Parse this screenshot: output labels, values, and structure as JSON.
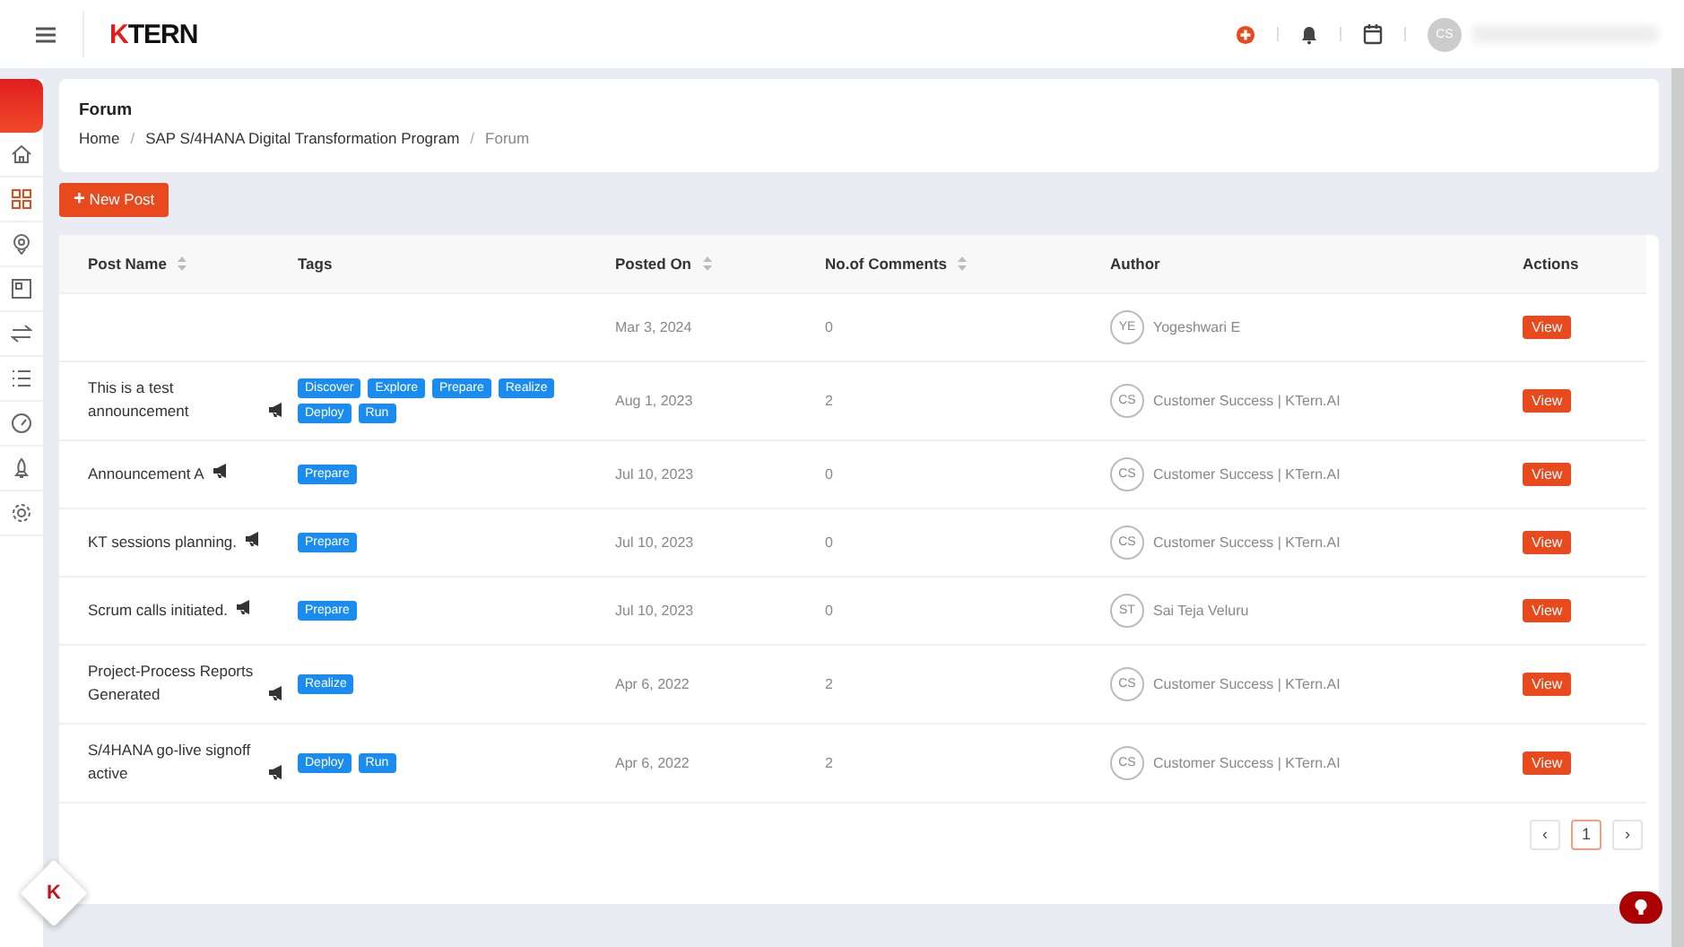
{
  "topbar": {
    "logo": {
      "mark": "K",
      "text": "TERN"
    },
    "avatar_initials": "CS"
  },
  "sidebar": {
    "items": [
      {
        "selected": false
      },
      {
        "selected": true
      },
      {
        "selected": false
      },
      {
        "selected": false
      },
      {
        "selected": false
      },
      {
        "selected": false
      },
      {
        "selected": false
      },
      {
        "selected": false
      },
      {
        "selected": false
      }
    ]
  },
  "page": {
    "title": "Forum",
    "breadcrumb": [
      "Home",
      "SAP S/4HANA Digital Transformation Program",
      "Forum"
    ],
    "breadcrumb_separator": "/"
  },
  "new_post_button": {
    "icon": "+",
    "label": "New Post"
  },
  "table": {
    "columns": [
      {
        "label": "Post Name",
        "sortable": true
      },
      {
        "label": "Tags",
        "sortable": false
      },
      {
        "label": "Posted On",
        "sortable": true
      },
      {
        "label": "No.of Comments",
        "sortable": true
      },
      {
        "label": "Author",
        "sortable": false
      },
      {
        "label": "Actions",
        "sortable": false
      }
    ],
    "rows": [
      {
        "name": "",
        "announcement": false,
        "tags": [],
        "posted_on": "Mar 3, 2024",
        "comments": "0",
        "author_initials": "YE",
        "author": "Yogeshwari E",
        "action": "View"
      },
      {
        "name": "This is a test announcement",
        "announcement": true,
        "tags": [
          "Discover",
          "Explore",
          "Prepare",
          "Realize",
          "Deploy",
          "Run"
        ],
        "posted_on": "Aug 1, 2023",
        "comments": "2",
        "author_initials": "CS",
        "author": "Customer Success | KTern.AI",
        "action": "View"
      },
      {
        "name": "Announcement A",
        "announcement": true,
        "tags": [
          "Prepare"
        ],
        "posted_on": "Jul 10, 2023",
        "comments": "0",
        "author_initials": "CS",
        "author": "Customer Success | KTern.AI",
        "action": "View"
      },
      {
        "name": "KT sessions planning.",
        "announcement": true,
        "tags": [
          "Prepare"
        ],
        "posted_on": "Jul 10, 2023",
        "comments": "0",
        "author_initials": "CS",
        "author": "Customer Success | KTern.AI",
        "action": "View"
      },
      {
        "name": "Scrum calls initiated.",
        "announcement": true,
        "tags": [
          "Prepare"
        ],
        "posted_on": "Jul 10, 2023",
        "comments": "0",
        "author_initials": "ST",
        "author": "Sai Teja Veluru",
        "action": "View"
      },
      {
        "name": "Project-Process Reports Generated",
        "announcement": true,
        "tags": [
          "Realize"
        ],
        "posted_on": "Apr 6, 2022",
        "comments": "2",
        "author_initials": "CS",
        "author": "Customer Success | KTern.AI",
        "action": "View"
      },
      {
        "name": "S/4HANA go-live signoff active",
        "announcement": true,
        "tags": [
          "Deploy",
          "Run"
        ],
        "posted_on": "Apr 6, 2022",
        "comments": "2",
        "author_initials": "CS",
        "author": "Customer Success | KTern.AI",
        "action": "View"
      }
    ]
  },
  "pagination": {
    "prev": "‹",
    "pages": [
      {
        "label": "1",
        "selected": true
      }
    ],
    "next": "›"
  },
  "floating": {
    "logo_mark": "K"
  }
}
